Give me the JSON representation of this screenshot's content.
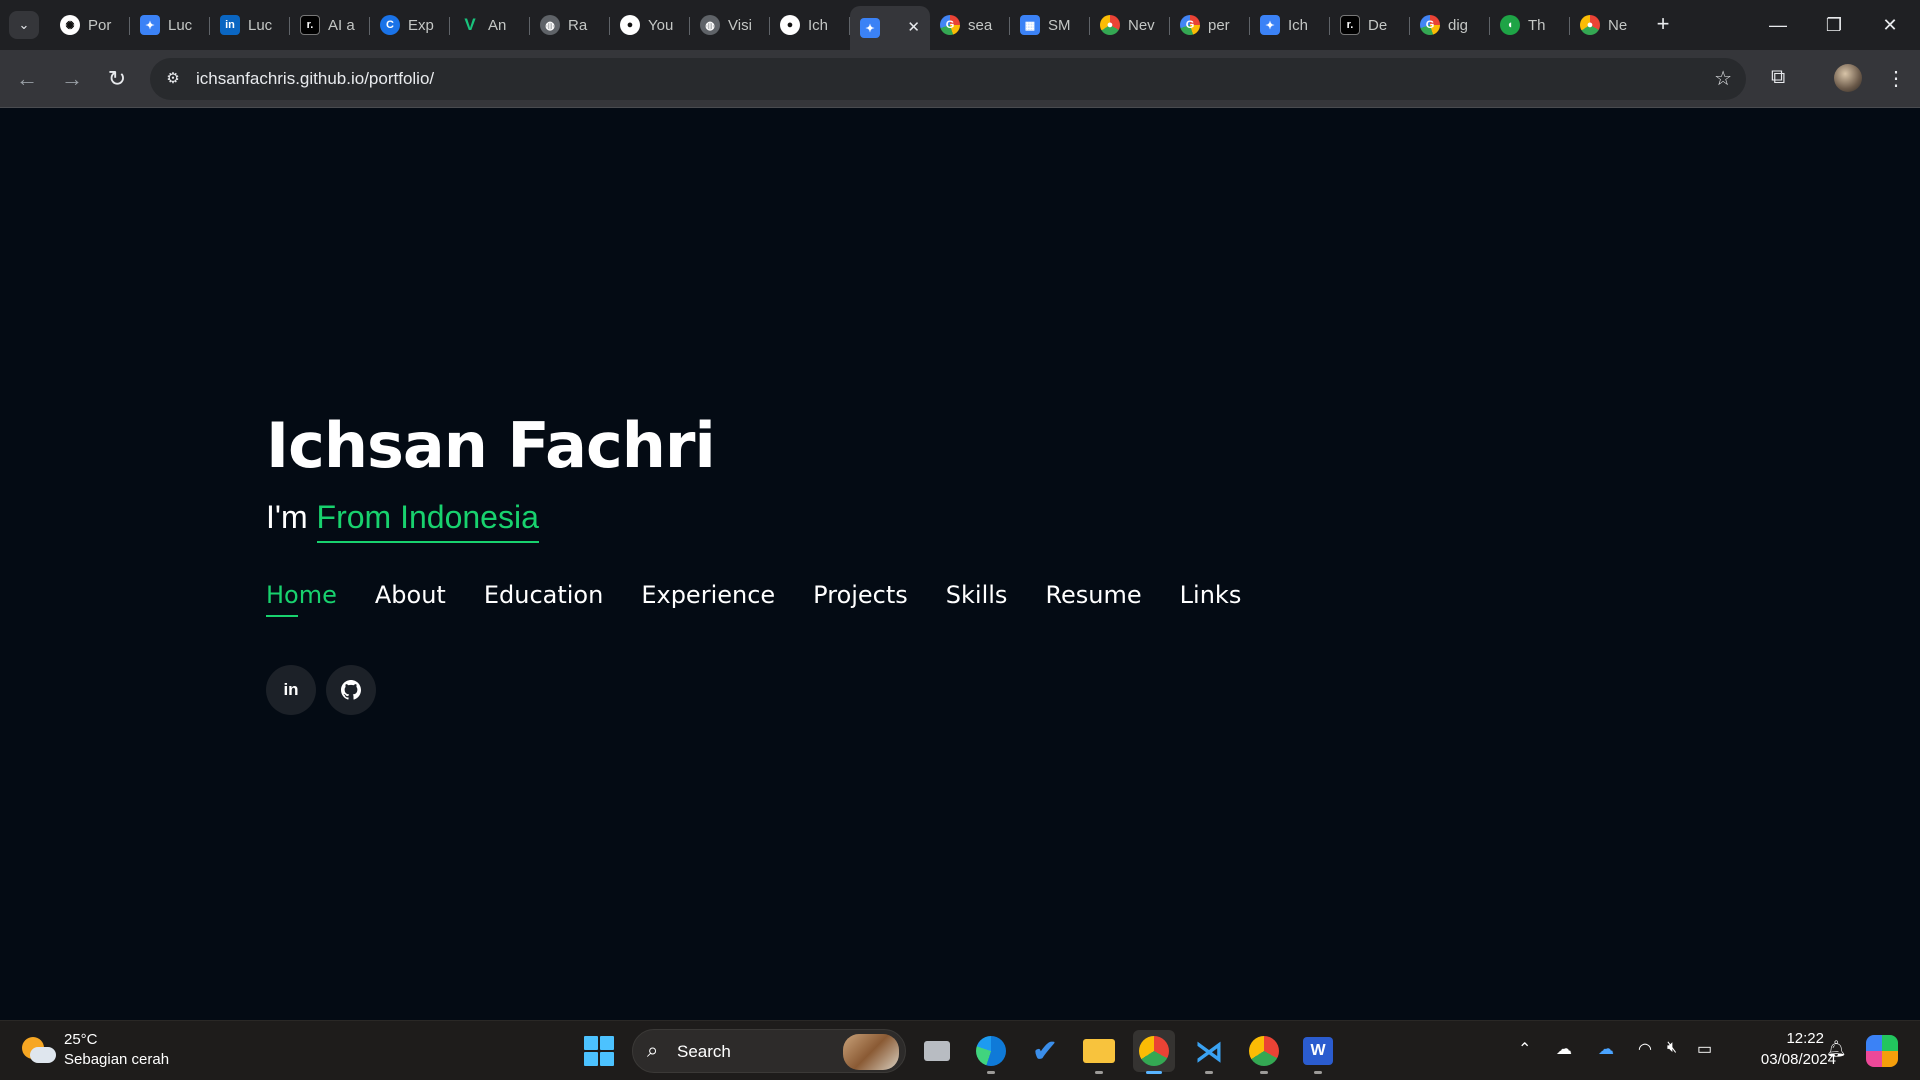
{
  "browser": {
    "tabs": [
      {
        "favicon": "chatgpt-icon",
        "title": "Por"
      },
      {
        "favicon": "portfolio-icon",
        "title": "Luc"
      },
      {
        "favicon": "linkedin-icon",
        "title": "Luc"
      },
      {
        "favicon": "dev-icon",
        "title": "AI a"
      },
      {
        "favicon": "c-icon",
        "title": "Exp"
      },
      {
        "favicon": "v-icon",
        "title": "An"
      },
      {
        "favicon": "globe-icon",
        "title": "Ra"
      },
      {
        "favicon": "github-icon",
        "title": "You"
      },
      {
        "favicon": "globe-icon",
        "title": "Visi"
      },
      {
        "favicon": "github-icon",
        "title": "Ich"
      },
      {
        "favicon": "portfolio-icon",
        "title": "",
        "active": true
      },
      {
        "favicon": "google-icon",
        "title": "sea"
      },
      {
        "favicon": "sm-icon",
        "title": "SM"
      },
      {
        "favicon": "chrome-icon",
        "title": "Nev"
      },
      {
        "favicon": "google-icon",
        "title": "per"
      },
      {
        "favicon": "portfolio-icon",
        "title": "Ich"
      },
      {
        "favicon": "dev-icon",
        "title": "De"
      },
      {
        "favicon": "google-icon",
        "title": "dig"
      },
      {
        "favicon": "green-icon",
        "title": "Th"
      },
      {
        "favicon": "chrome-icon",
        "title": "Ne"
      }
    ],
    "url": "ichsanfachris.github.io/portfolio/"
  },
  "page": {
    "name": "Ichsan Fachri",
    "tagline_prefix": "I'm",
    "tagline_typed": "From Indonesia",
    "nav": [
      "Home",
      "About",
      "Education",
      "Experience",
      "Projects",
      "Skills",
      "Resume",
      "Links"
    ],
    "active_nav": "Home",
    "social": [
      {
        "icon": "linkedin-icon",
        "glyph": "in"
      },
      {
        "icon": "github-icon",
        "glyph": "●"
      }
    ]
  },
  "taskbar": {
    "weather_temp": "25°C",
    "weather_desc": "Sebagian cerah",
    "search_label": "Search",
    "clock_time": "12:22",
    "clock_date": "03/08/2024"
  },
  "colors": {
    "accent": "#18d26e",
    "background": "#040b14"
  }
}
